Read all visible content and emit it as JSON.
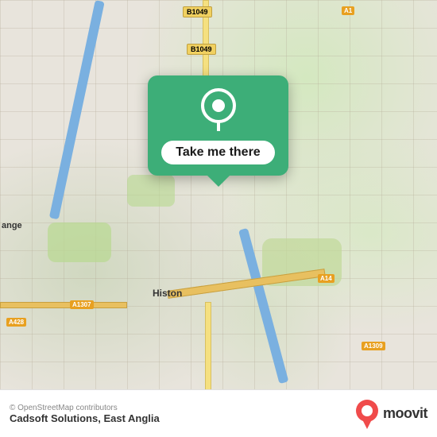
{
  "map": {
    "attribution": "© OpenStreetMap contributors",
    "popup": {
      "label": "Take me there"
    },
    "roads": {
      "b1049_top": "B1049",
      "b1049_bottom": "B1049",
      "a14": "A14",
      "a1307": "A1307",
      "a428": "A428",
      "a1309": "A1309"
    },
    "town": "Histon"
  },
  "footer": {
    "copyright": "© OpenStreetMap contributors",
    "title": "Cadsoft Solutions, East Anglia",
    "logo": "moovit"
  },
  "icons": {
    "location-pin": "📍",
    "moovit-pin": "📍"
  }
}
